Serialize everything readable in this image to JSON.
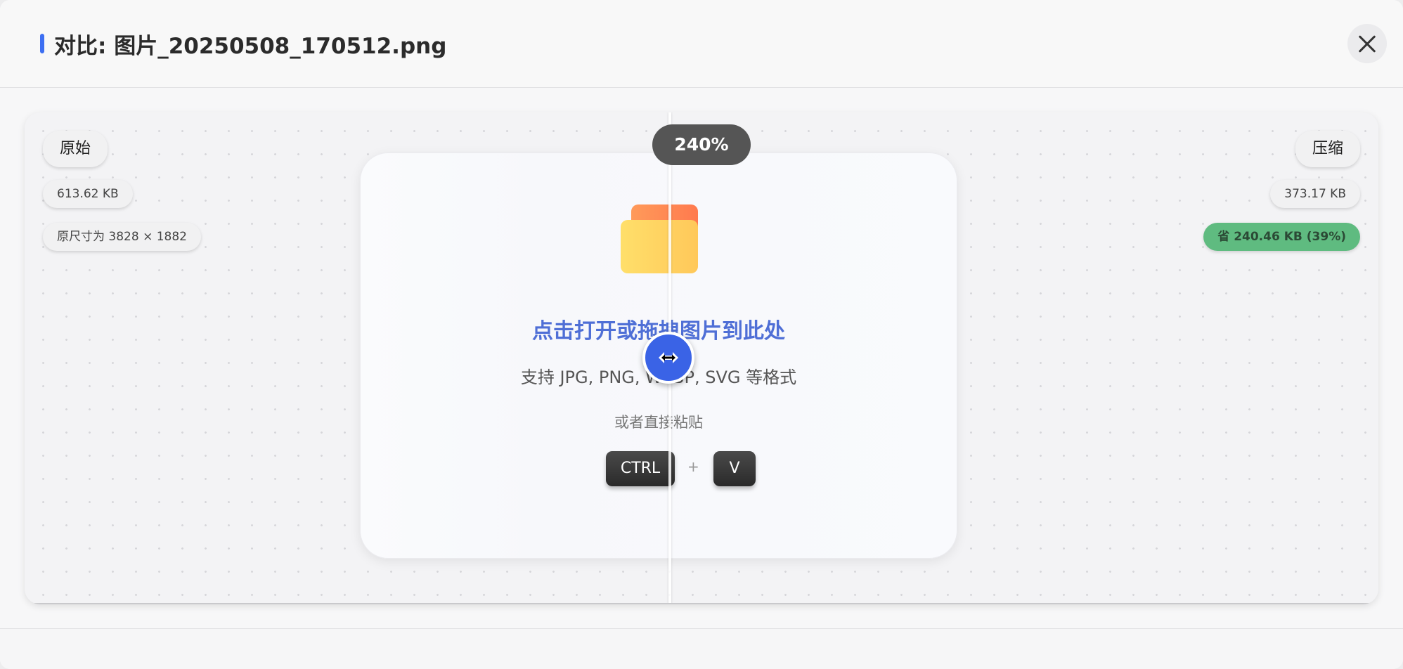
{
  "header": {
    "title": "对比: 图片_20250508_170512.png"
  },
  "compare": {
    "zoom": "240%",
    "original": {
      "label": "原始",
      "size": "613.62 KB",
      "dimensions": "原尺寸为 3828 × 1882"
    },
    "compressed": {
      "label": "压缩",
      "size": "373.17 KB",
      "savings": "省 240.46 KB (39%)"
    }
  },
  "dropzone": {
    "headline": "点击打开或拖拽图片到此处",
    "formats": "支持 JPG, PNG, WEBP, SVG 等格式",
    "paste_hint": "或者直接粘贴",
    "key_ctrl": "CTRL",
    "key_plus": "+",
    "key_v": "V"
  },
  "icons": {
    "close": "close-icon",
    "folder": "folder-icon",
    "drag": "horizontal-arrows-icon"
  },
  "colors": {
    "accent": "#3d6ff2",
    "savings_badge": "#5fbb80",
    "headline": "#4f6fd6",
    "zoom_badge": "#555555"
  }
}
